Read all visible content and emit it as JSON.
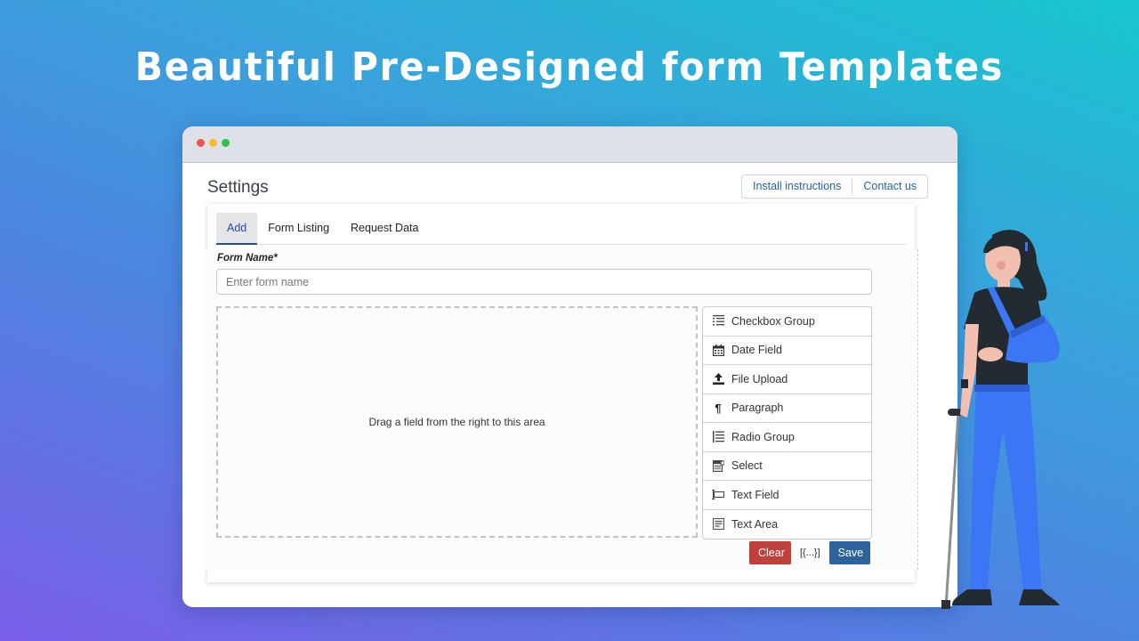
{
  "hero": {
    "title": "Beautiful Pre-Designed form Templates"
  },
  "window": {
    "controls": [
      "close",
      "minimize",
      "maximize"
    ],
    "colors": {
      "close": "#f0524f",
      "minimize": "#f7b92d",
      "maximize": "#2ec348"
    }
  },
  "header": {
    "title": "Settings",
    "links": [
      {
        "label": "Install instructions"
      },
      {
        "label": "Contact us"
      }
    ]
  },
  "tabs": [
    {
      "label": "Add",
      "active": true
    },
    {
      "label": "Form Listing",
      "active": false
    },
    {
      "label": "Request Data",
      "active": false
    }
  ],
  "form": {
    "name_label": "Form Name*",
    "name_placeholder": "Enter form name",
    "name_value": "",
    "drop_zone_text": "Drag a field from the right to this area"
  },
  "fields": [
    {
      "label": "Checkbox Group",
      "icon": "checkbox-list-icon"
    },
    {
      "label": "Date Field",
      "icon": "calendar-icon"
    },
    {
      "label": "File Upload",
      "icon": "upload-icon"
    },
    {
      "label": "Paragraph",
      "icon": "paragraph-icon"
    },
    {
      "label": "Radio Group",
      "icon": "radio-list-icon"
    },
    {
      "label": "Select",
      "icon": "select-icon"
    },
    {
      "label": "Text Field",
      "icon": "text-field-icon"
    },
    {
      "label": "Text Area",
      "icon": "text-area-icon"
    }
  ],
  "actions": {
    "clear_label": "Clear",
    "json_label": "[{...}]",
    "save_label": "Save",
    "colors": {
      "clear": "#c0403c",
      "save": "#2d639c"
    }
  },
  "illustration": {
    "description": "woman-with-arm-sling-and-crutch"
  }
}
